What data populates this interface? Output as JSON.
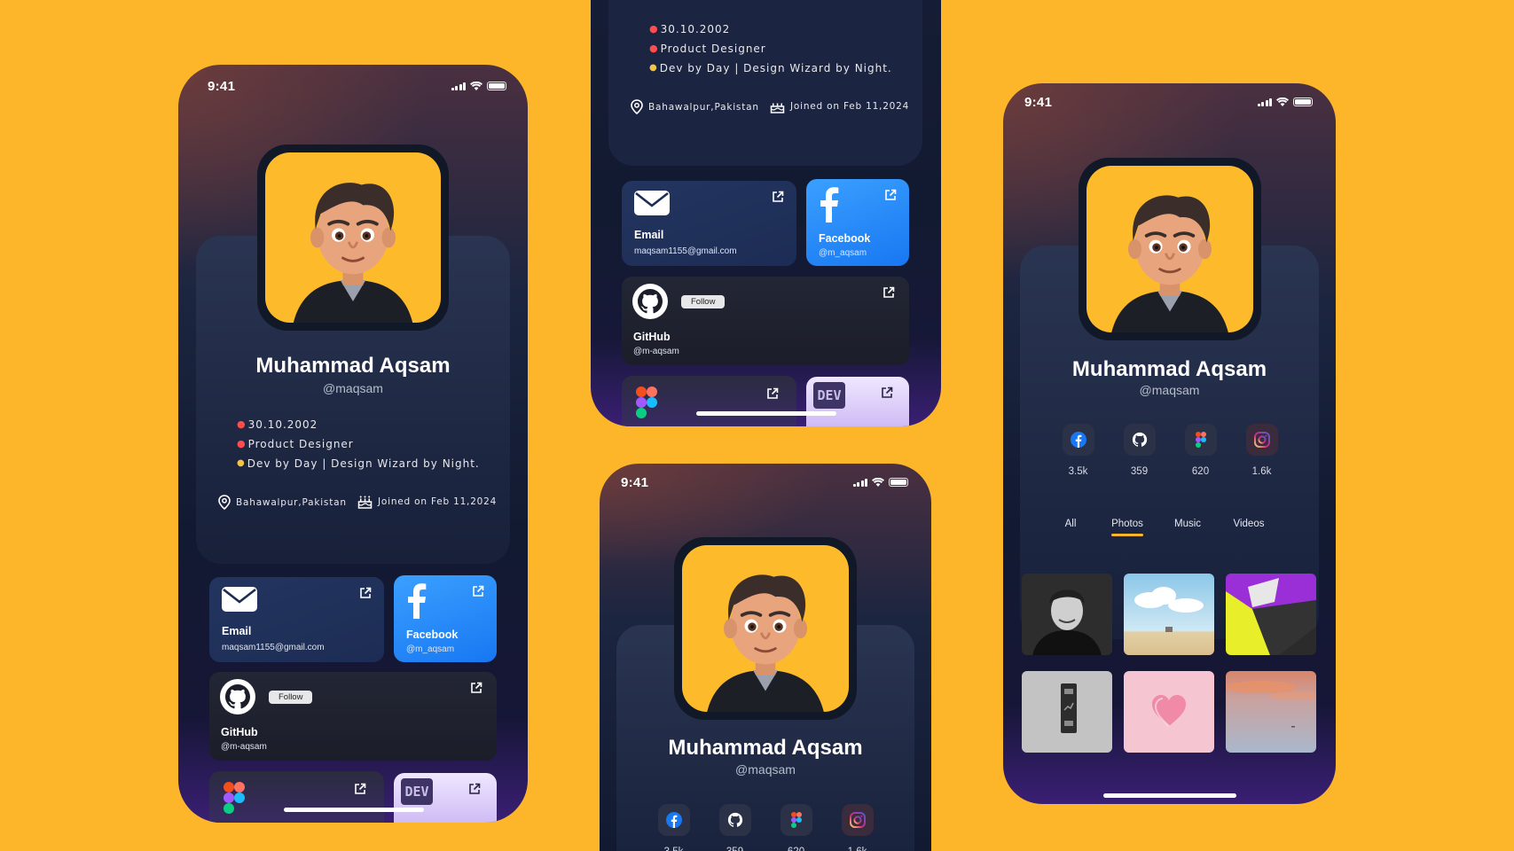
{
  "status_time": "9:41",
  "profile": {
    "name": "Muhammad Aqsam",
    "handle": "@maqsam",
    "bio": [
      "30.10.2002",
      "Product Designer",
      "Dev by Day | Design Wizard by Night."
    ],
    "location": "Bahawalpur,Pakistan",
    "joined": "Joined on Feb 11,2024"
  },
  "links": {
    "email": {
      "title": "Email",
      "sub": "maqsam1155@gmail.com"
    },
    "facebook": {
      "title": "Facebook",
      "sub": "@m_aqsam"
    },
    "github": {
      "title": "GitHub",
      "sub": "@m-aqsam",
      "follow": "Follow"
    },
    "figma": {
      "title": "Figma"
    },
    "dev": {
      "title": "DEV"
    }
  },
  "stats": [
    {
      "icon": "facebook-icon",
      "count": "3.5k"
    },
    {
      "icon": "github-icon",
      "count": "359"
    },
    {
      "icon": "figma-icon",
      "count": "620"
    },
    {
      "icon": "instagram-icon",
      "count": "1.6k"
    }
  ],
  "tabs": [
    "All",
    "Photos",
    "Music",
    "Videos"
  ],
  "active_tab": "Photos",
  "photos": [
    "portrait-photo",
    "sky-field-photo",
    "abstract-shapes-photo",
    "elevator-sign-photo",
    "heart-photo",
    "sunset-sky-photo"
  ],
  "colors": {
    "background": "#FDB52A",
    "accent": "#FDB52A",
    "facebook": "#1877F2"
  }
}
